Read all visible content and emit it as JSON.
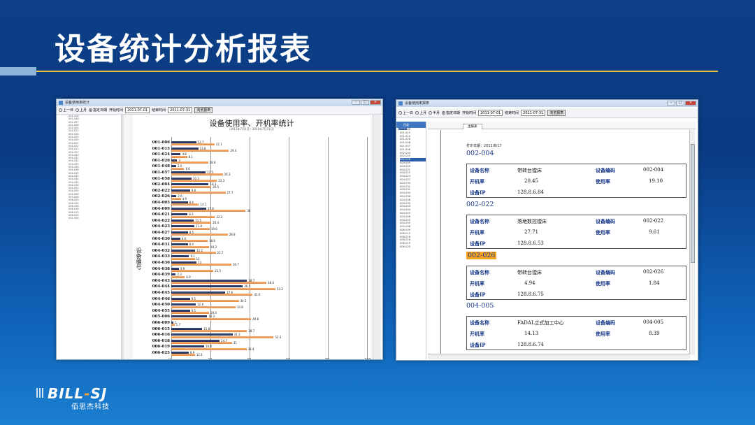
{
  "slide": {
    "title": "设备统计分析报表",
    "logo_text_a": "BILL",
    "logo_text_dash": "-",
    "logo_text_b": "SJ",
    "logo_sub": "佰思杰科技"
  },
  "window1": {
    "title": "设备使用率统计",
    "toolbar": {
      "opt_day": "上一日",
      "opt_month": "上月",
      "opt_custom": "指定日期",
      "start_label": "开始时间",
      "start_value": "2011-07-01",
      "end_label": "结束时间",
      "end_value": "2011-07-31",
      "browse_button": "浏览报表"
    },
    "device_list": [
      "001-026",
      "001-048",
      "001-057",
      "001-058",
      "002-004",
      "002-022",
      "002-026",
      "004-005",
      "004-009",
      "004-021",
      "004-022",
      "004-023",
      "004-027",
      "004-030",
      "004-031",
      "004-032",
      "004-033",
      "004-036",
      "004-038",
      "004-039",
      "004-043",
      "004-044",
      "004-045",
      "004-046",
      "004-050",
      "004-055",
      "004-056",
      "005-006",
      "006-009",
      "006-015",
      "006-016",
      "006-018",
      "006-019",
      "006-025",
      "001-006"
    ],
    "chart_title": "设备使用率、开机率统计",
    "chart_subtitle": "（2011年7月1日 - 2011年7月31日）",
    "y_axis_label": "设备编号"
  },
  "chart_data": {
    "type": "bar",
    "orientation": "horizontal",
    "title": "设备使用率、开机率统计",
    "subtitle": "（2011年7月1日 - 2011年7月31日）",
    "ylabel": "设备编号",
    "xlim": [
      0,
      100
    ],
    "x_ticks": [
      "0",
      "20",
      "40",
      "60",
      "80",
      "100"
    ],
    "grid": true,
    "categories": [
      "001-006",
      "001-015",
      "001-024",
      "001-026",
      "001-048",
      "001-057",
      "001-058",
      "002-004",
      "002-022",
      "002-026",
      "004-005",
      "004-009",
      "004-021",
      "004-022",
      "004-023",
      "004-027",
      "004-030",
      "004-031",
      "004-032",
      "004-033",
      "004-036",
      "004-038",
      "004-039",
      "004-043",
      "004-044",
      "004-045",
      "004-046",
      "004-050",
      "004-055",
      "005-006",
      "006-009",
      "006-015",
      "006-016",
      "006-018",
      "006-019",
      "006-025"
    ],
    "series": [
      {
        "values": [
          12.7,
          13.8,
          4.8,
          3.0,
          2.5,
          17.5,
          10.3,
          19.1,
          9.6,
          2.6,
          8.4,
          17.8,
          8.3,
          11.5,
          11.8,
          8.5,
          4.6,
          8.4,
          12.2,
          9.1,
          13.0,
          3.9,
          2.3,
          38.7,
          36.5,
          27.6,
          9.5,
          12.6,
          9.5,
          18.3,
          1.0,
          15.8,
          31.3,
          24.7,
          16.8,
          8.9
        ]
      },
      {
        "values": [
          22.1,
          29.4,
          8.1,
          18.8,
          6.6,
          26.3,
          23.3,
          20.5,
          27.7,
          4.9,
          14.1,
          38.0,
          22.3,
          20.4,
          19.6,
          28.8,
          18.6,
          19.3,
          22.7,
          12.0,
          30.7,
          21.5,
          6.9,
          48.6,
          53.2,
          41.6,
          34.5,
          32.8,
          19.3,
          40.8,
          1.7,
          38.7,
          52.3,
          31.0,
          38.4,
          12.1
        ]
      }
    ]
  },
  "window2": {
    "title": "设备使用率报表",
    "toolbar": {
      "opt_day": "上一日",
      "opt_month": "上月",
      "opt_year": "半月",
      "opt_custom": "指定日期",
      "start_label": "开始时间",
      "start_value": "2011-07-01",
      "end_label": "结束时间",
      "end_value": "2011-07-31",
      "browse_button": "浏览报表"
    },
    "tree_header": "目录",
    "tab_label": "主报表",
    "tree_items": [
      "001-006",
      "001-015",
      "001-024",
      "001-026",
      "001-048",
      "001-057",
      "001-058",
      "002-004",
      "002-022",
      "002-026",
      "004-005",
      "004-009",
      "004-021",
      "004-022",
      "004-023",
      "004-027",
      "004-030",
      "004-031",
      "004-032",
      "004-033",
      "004-036",
      "004-038",
      "004-039",
      "004-043",
      "004-044",
      "004-045",
      "004-046",
      "004-050",
      "004-055",
      "005-006",
      "006-009",
      "006-015",
      "006-016",
      "006-018",
      "006-019",
      "006-025"
    ],
    "print_date": "打印日期：2011/8/17",
    "labels": {
      "name": "设备名称",
      "code": "设备编码",
      "open_rate": "开机率",
      "use_rate": "使用率",
      "ip": "设备IP"
    },
    "records": [
      {
        "group": "002-004",
        "name": "带转台镗床",
        "code": "002-004",
        "open_rate": "20.45",
        "use_rate": "19.10",
        "ip": "128.8.6.84"
      },
      {
        "group": "002-022",
        "name": "落地数控镗床",
        "code": "002-022",
        "open_rate": "27.71",
        "use_rate": "9.61",
        "ip": "128.8.6.53"
      },
      {
        "group": "002-026",
        "name": "带转台镗床",
        "code": "002-026",
        "open_rate": "4.94",
        "use_rate": "1.84",
        "ip": "128.8.6.75"
      },
      {
        "group": "004-005",
        "name": "FADAL立式加工中心",
        "code": "004-005",
        "open_rate": "14.13",
        "use_rate": "8.39",
        "ip": "128.8.6.74"
      }
    ]
  }
}
